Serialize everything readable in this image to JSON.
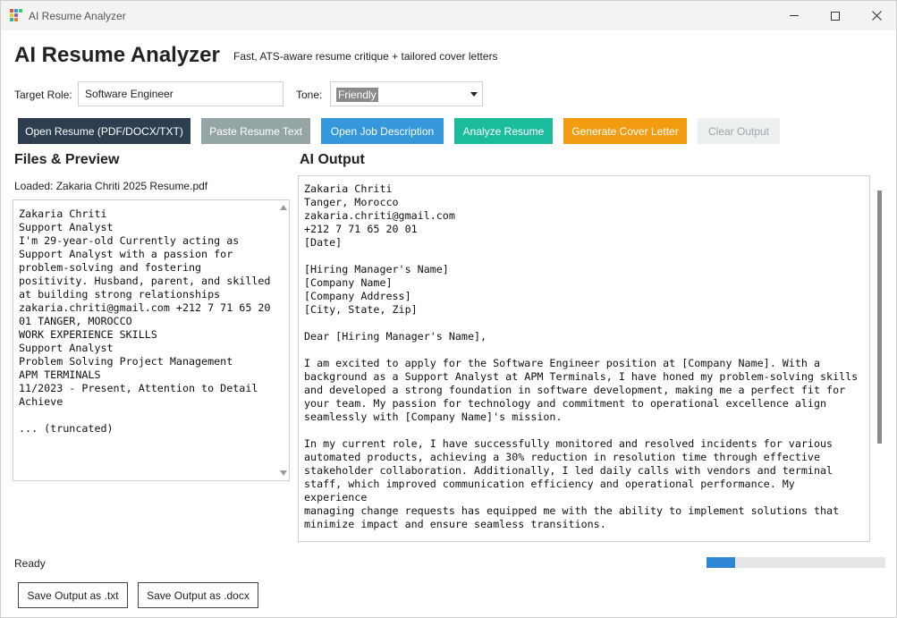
{
  "window": {
    "title": "AI Resume Analyzer",
    "controls": {
      "minimize": "minimize-icon",
      "maximize": "maximize-icon",
      "close": "close-icon"
    }
  },
  "header": {
    "title": "AI Resume Analyzer",
    "subtitle": "Fast, ATS-aware resume critique + tailored cover letters"
  },
  "form": {
    "target_role_label": "Target Role:",
    "target_role_value": "Software Engineer",
    "tone_label": "Tone:",
    "tone_value": "Friendly"
  },
  "toolbar": {
    "open_resume": "Open Resume (PDF/DOCX/TXT)",
    "paste_resume": "Paste Resume Text",
    "open_job": "Open Job Description",
    "analyze": "Analyze Resume",
    "generate_cover": "Generate Cover Letter",
    "clear_output": "Clear Output"
  },
  "colors": {
    "open_resume": "#2c3e50",
    "paste_resume": "#95a5a6",
    "open_job": "#3498db",
    "analyze": "#1abc9c",
    "generate_cover": "#f39c12",
    "clear_output": "#ecf0f1",
    "progress": "#2f86d4"
  },
  "files_panel": {
    "heading": "Files & Preview",
    "loaded": "Loaded: Zakaria Chriti 2025 Resume.pdf",
    "preview": "Zakaria Chriti\nSupport Analyst\nI'm 29-year-old Currently acting as\nSupport Analyst with a passion for\nproblem-solving and fostering\npositivity. Husband, parent, and skilled\nat building strong relationships\nzakaria.chriti@gmail.com +212 7 71 65 20\n01 TANGER, MOROCCO\nWORK EXPERIENCE SKILLS\nSupport Analyst\nProblem Solving Project Management\nAPM TERMINALS\n11/2023 - Present, Attention to Detail\nAchieve\n\n... (truncated)"
  },
  "output_panel": {
    "heading": "AI Output",
    "text": "Zakaria Chriti\nTanger, Morocco\nzakaria.chriti@gmail.com\n+212 7 71 65 20 01\n[Date]\n\n[Hiring Manager's Name]\n[Company Name]\n[Company Address]\n[City, State, Zip]\n\nDear [Hiring Manager's Name],\n\nI am excited to apply for the Software Engineer position at [Company Name]. With a\nbackground as a Support Analyst at APM Terminals, I have honed my problem-solving skills\nand developed a strong foundation in software development, making me a perfect fit for\nyour team. My passion for technology and commitment to operational excellence align\nseamlessly with [Company Name]'s mission.\n\nIn my current role, I have successfully monitored and resolved incidents for various\nautomated products, achieving a 30% reduction in resolution time through effective\nstakeholder collaboration. Additionally, I led daily calls with vendors and terminal\nstaff, which improved communication efficiency and operational performance. My experience\nmanaging change requests has equipped me with the ability to implement solutions that\nminimize impact and ensure seamless transitions.\n\nI am particularly drawn to this opportunity because of [specific aspect of the company or"
  },
  "status": {
    "text": "Ready",
    "progress_fraction": 0.16
  },
  "footer": {
    "save_txt": "Save Output as .txt",
    "save_docx": "Save Output as .docx"
  }
}
